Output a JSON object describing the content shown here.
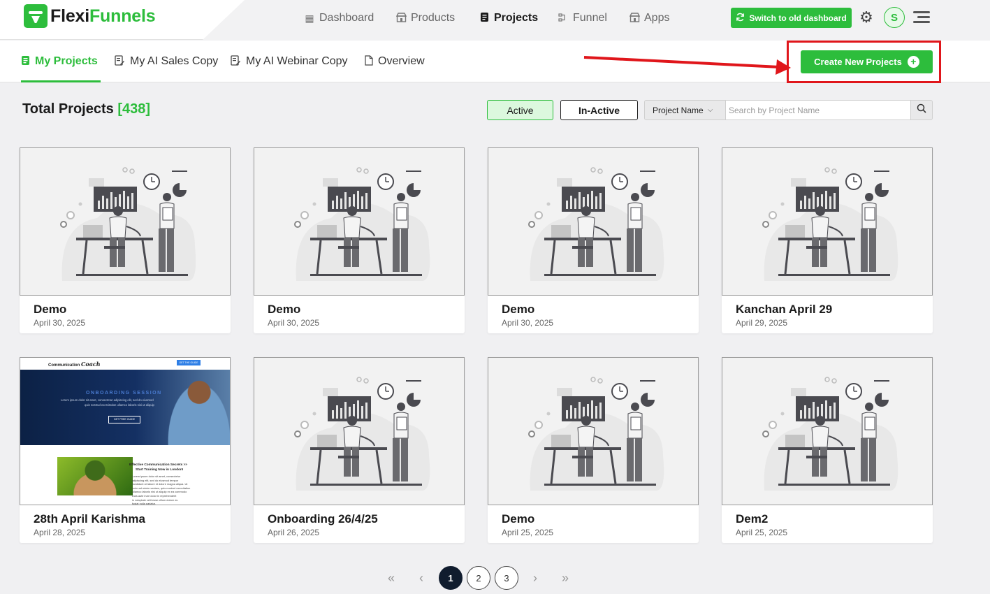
{
  "brand": {
    "name_part1": "Flexi",
    "name_part2": "Funnels",
    "accent": "#2dbd3c"
  },
  "topnav": [
    {
      "label": "Dashboard",
      "icon": "grid-icon"
    },
    {
      "label": "Products",
      "icon": "store-icon"
    },
    {
      "label": "Projects",
      "icon": "document-icon",
      "active": true
    },
    {
      "label": "Funnel",
      "icon": "funnel-icon"
    },
    {
      "label": "Apps",
      "icon": "apps-store-icon"
    }
  ],
  "header": {
    "switch_label": "Switch to old dashboard",
    "avatar_initial": "S"
  },
  "tabs": [
    {
      "label": "My Projects",
      "active": true
    },
    {
      "label": "My AI Sales Copy"
    },
    {
      "label": "My AI Webinar Copy"
    },
    {
      "label": "Overview"
    }
  ],
  "create_button": "Create New Projects",
  "summary": {
    "label": "Total Projects",
    "count": "[438]"
  },
  "filters": {
    "active_label": "Active",
    "inactive_label": "In-Active",
    "select_value": "Project Name",
    "search_placeholder": "Search by Project Name"
  },
  "projects": [
    {
      "title": "Demo",
      "date": "April 30, 2025"
    },
    {
      "title": "Demo",
      "date": "April 30, 2025"
    },
    {
      "title": "Demo",
      "date": "April 30, 2025"
    },
    {
      "title": "Kanchan April 29",
      "date": "April 29, 2025"
    },
    {
      "title": "28th April Karishma",
      "date": "April 28, 2025",
      "thumbnail": "landing-page"
    },
    {
      "title": "Onboarding 26/4/25",
      "date": "April 26, 2025"
    },
    {
      "title": "Demo",
      "date": "April 25, 2025"
    },
    {
      "title": "Dem2",
      "date": "April 25, 2025"
    }
  ],
  "landing_thumb": {
    "logo_text": "Communication",
    "logo_script": "Coach",
    "cta_top": "GET THE GUIDE",
    "hero_title": "ONBOARDING SESSION",
    "hero_text_1": "Lorem ipsum dolor sit amet, consectetur adipiscing elit, sed do eiusmod",
    "hero_text_2": "quis nostrud exercitation ullamco laboris nisi ut aliquip",
    "hero_cta": "GET FREE GUIDE",
    "section_title_1": "Effective Communication Secrets >>",
    "section_title_2": "Start Training Now in London!",
    "body_lines": [
      "Lorem ipsum dolor sit amet, consectetur",
      "adipiscing elit, sed do eiusmod tempor",
      "incididunt ut labore et dolore magna aliqua. Ut",
      "enim ad minim veniam, quis nostrud exercitation",
      "ullamco laboris nisi ut aliquip ex ea commodo",
      "Duis aute irure dolor in reprehenderit",
      "in voluptate velit esse cillum dolore eu",
      "fugiat nulla pariatur."
    ]
  },
  "pagination": {
    "pages": [
      "1",
      "2",
      "3"
    ],
    "current": "1"
  }
}
